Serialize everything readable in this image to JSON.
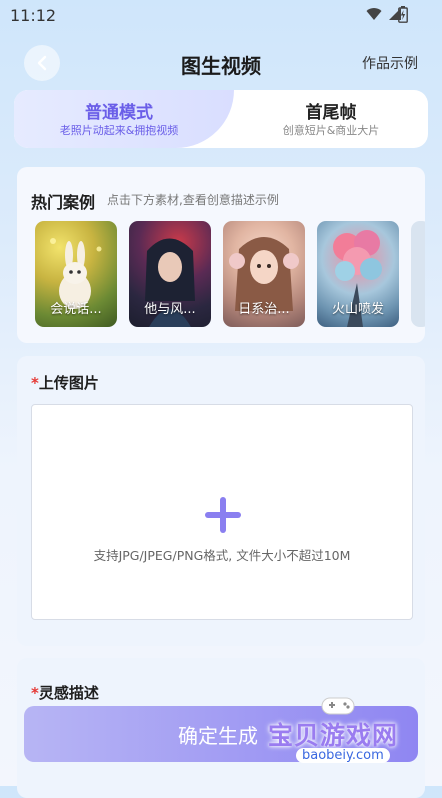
{
  "status": {
    "time": "11:12"
  },
  "header": {
    "title": "图生视频",
    "samples_label": "作品示例"
  },
  "tabs": [
    {
      "title": "普通模式",
      "subtitle": "老照片动起来&拥抱视频"
    },
    {
      "title": "首尾帧",
      "subtitle": "创意短片&商业大片"
    }
  ],
  "hot": {
    "title": "热门案例",
    "subtitle": "点击下方素材,查看创意描述示例",
    "cases": [
      {
        "label": "会说话..."
      },
      {
        "label": "他与风..."
      },
      {
        "label": "日系治..."
      },
      {
        "label": "火山喷发"
      }
    ]
  },
  "upload": {
    "required_mark": "*",
    "title": "上传图片",
    "hint": "支持JPG/JPEG/PNG格式, 文件大小不超过10M"
  },
  "inspiration": {
    "required_mark": "*",
    "title": "灵感描述"
  },
  "confirm": {
    "label": "确定生成"
  },
  "watermark": {
    "text": "宝贝游戏网",
    "url": "baobeiy.com"
  }
}
